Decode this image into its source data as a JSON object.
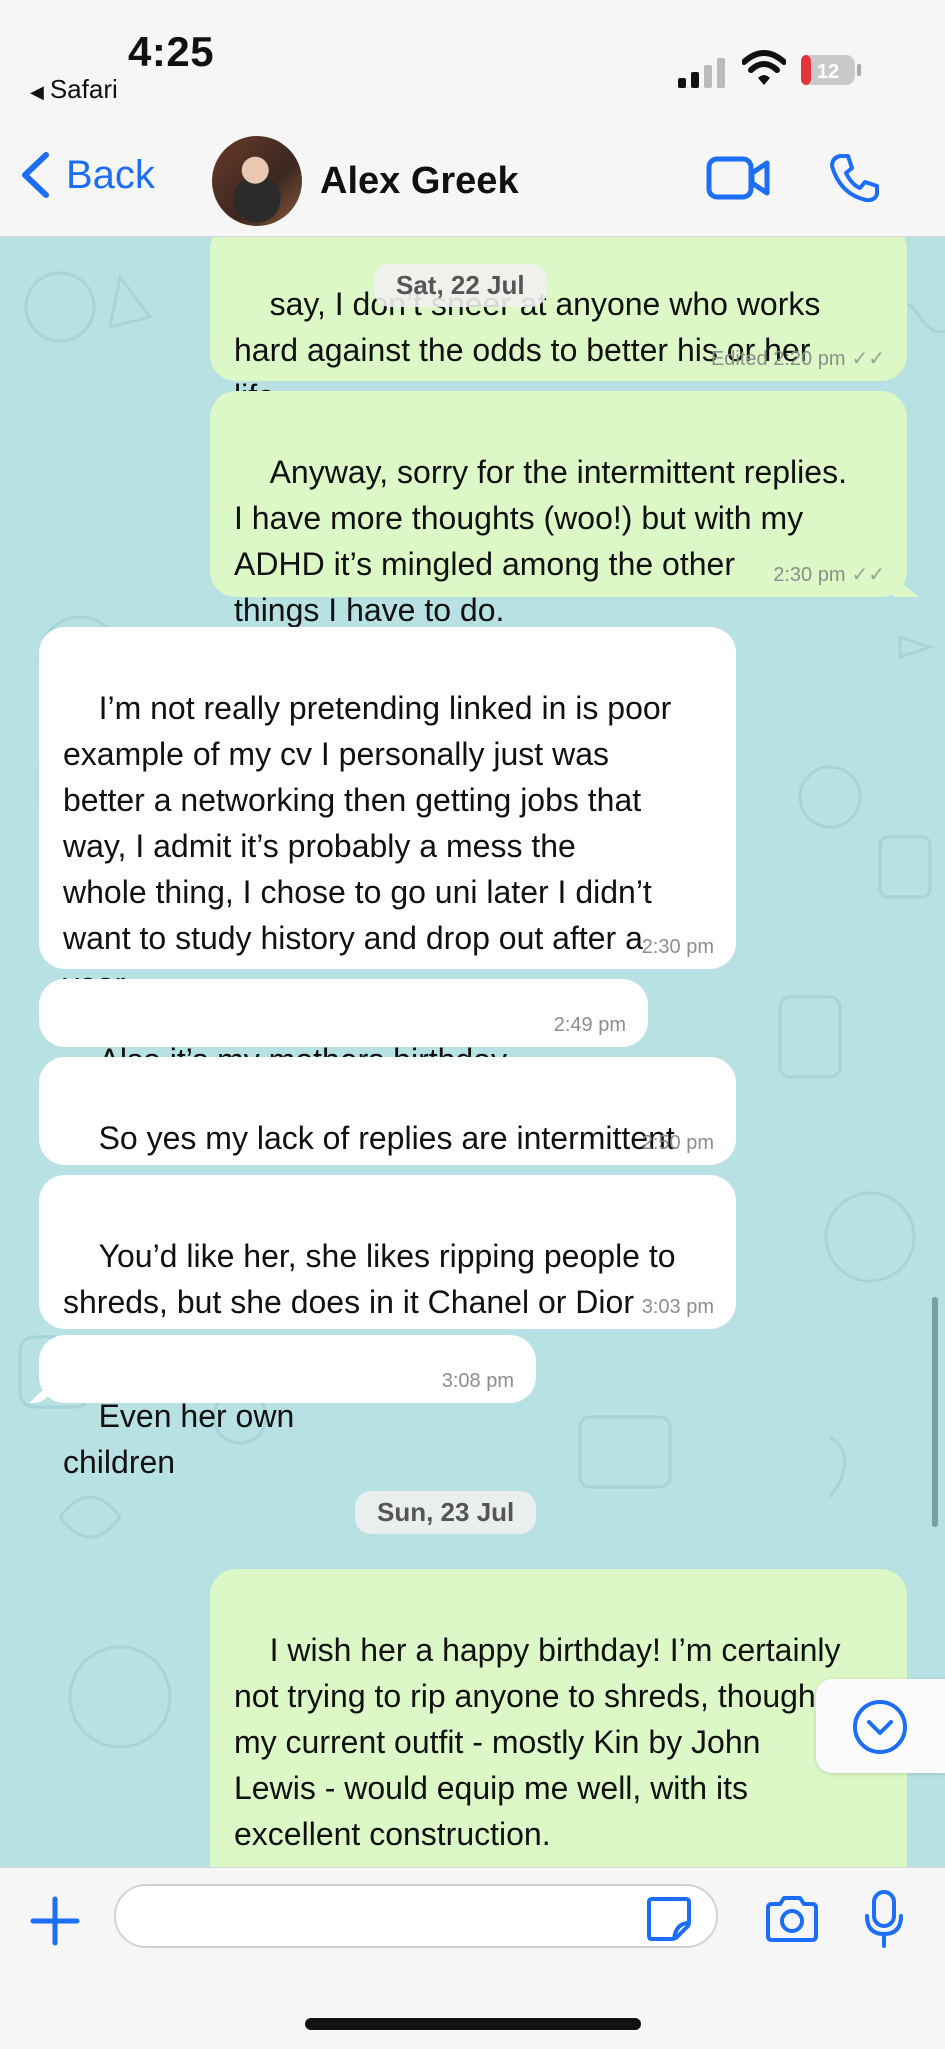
{
  "status_bar": {
    "time": "4:25",
    "back_app": "Safari",
    "battery": "12"
  },
  "header": {
    "back_label": "Back",
    "contact_name": "Alex Greek"
  },
  "messages": [
    {
      "dir": "out",
      "text": "say, I don’t sneer at anyone who works\nhard against the odds to better his or her\nlife.",
      "edited": "Edited",
      "time": "2:20 pm"
    },
    {
      "dir": "out",
      "text": "Anyway, sorry for the intermittent replies.\nI have more thoughts (woo!) but with my\nADHD it’s mingled among the other\nthings I have to do.",
      "time": "2:30 pm"
    },
    {
      "dir": "in",
      "text": "I’m not really pretending linked in is poor\nexample of my cv I personally just was\nbetter a networking then getting jobs that\nway, I admit it’s probably a mess the\nwhole thing, I chose to go uni later I didn’t\nwant to study history and drop out after a\nyear,",
      "time": "2:30 pm"
    },
    {
      "dir": "in",
      "text": "Also it’s my mothers birthday",
      "time": "2:49 pm"
    },
    {
      "dir": "in",
      "text": "So yes my lack of replies are intermittent",
      "time": "2:50 pm"
    },
    {
      "dir": "in",
      "text": "You’d like her, she likes ripping people to\nshreds, but she does in it Chanel or Dior",
      "time": "3:03 pm"
    },
    {
      "dir": "in",
      "text": "Even her own children",
      "time": "3:08 pm"
    },
    {
      "dir": "out",
      "text": "I wish her a happy birthday! I’m certainly\nnot trying to rip anyone to shreds, though\nmy current outfit - mostly Kin by John\nLewis - would equip me well, with its\nexcellent construction.\n\nAnyway, my point is that a quick glimpse"
    }
  ],
  "date_separators": [
    "Sat, 22 Jul",
    "Sun, 23 Jul"
  ],
  "colors": {
    "accent": "#1b6ef5",
    "outgoing_bubble": "#dcf8c6",
    "incoming_bubble": "#ffffff",
    "wallpaper": "#b7e1e3"
  },
  "icons": {
    "back": "chevron-left-icon",
    "video": "video-camera-icon",
    "call": "phone-icon",
    "attach": "plus-icon",
    "sticker": "sticker-icon",
    "camera": "camera-icon",
    "mic": "microphone-icon",
    "scroll": "chevron-down-circle-icon"
  }
}
